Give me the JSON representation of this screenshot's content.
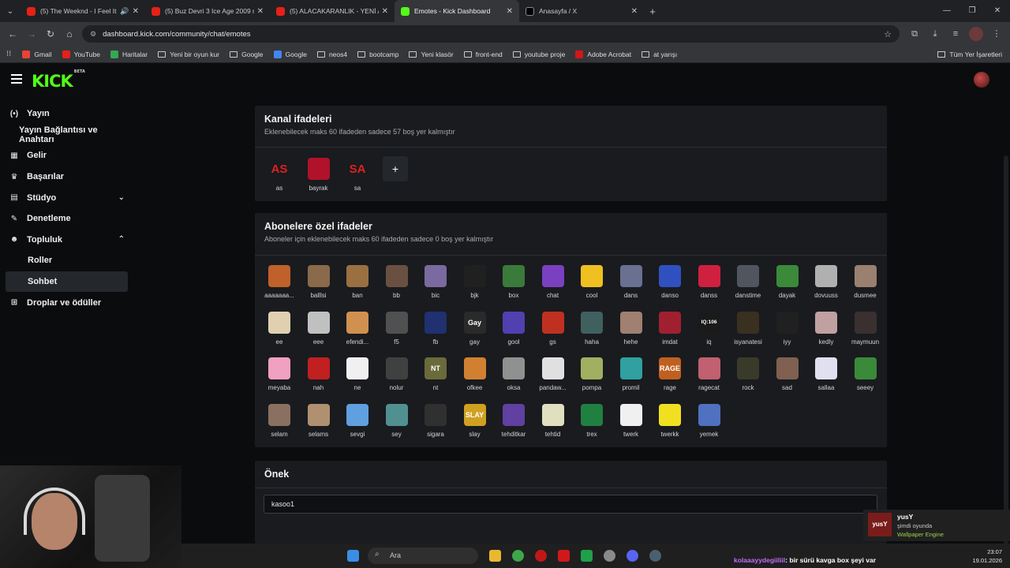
{
  "browser": {
    "tabs": [
      {
        "title": "(5) The Weeknd - I Feel It C",
        "favicon": "youtube",
        "audio": true
      },
      {
        "title": "(5) Buz Devri 3 Ice Age 2009 m",
        "favicon": "youtube"
      },
      {
        "title": "(5) ALACAKARANLIK - YENİ AY",
        "favicon": "youtube"
      },
      {
        "title": "Emotes - Kick Dashboard",
        "favicon": "kick",
        "active": true
      },
      {
        "title": "Anasayfa / X",
        "favicon": "x"
      }
    ],
    "url": "dashboard.kick.com/community/chat/emotes",
    "bookmarks": [
      "Gmail",
      "YouTube",
      "Haritalar",
      "Yeni bir oyun kur",
      "Google",
      "Google",
      "neos4",
      "bootcamp",
      "Yeni klasör",
      "front-end",
      "youtube proje",
      "Adobe Acrobat",
      "at yarışı"
    ],
    "bookmarks_right": "Tüm Yer İşaretleri"
  },
  "logo": {
    "text": "KICK",
    "badge": "BETA"
  },
  "sidebar": {
    "items": [
      {
        "label": "Yayın",
        "icon": "broadcast-icon"
      },
      {
        "label": "Yayın Bağlantısı ve Anahtarı",
        "sub": true
      },
      {
        "label": "Gelir",
        "icon": "revenue-icon"
      },
      {
        "label": "Başarılar",
        "icon": "trophy-icon"
      },
      {
        "label": "Stüdyo",
        "icon": "studio-icon",
        "chevron": "down"
      },
      {
        "label": "Denetleme",
        "icon": "wrench-icon"
      },
      {
        "label": "Topluluk",
        "icon": "people-icon",
        "chevron": "up"
      },
      {
        "label": "Roller",
        "sub2": true
      },
      {
        "label": "Sohbet",
        "sub2": true,
        "active": true
      },
      {
        "label": "Droplar ve ödüller",
        "icon": "gift-icon"
      }
    ]
  },
  "channel_emotes": {
    "title": "Kanal ifadeleri",
    "desc": "Eklenebilecek maks 60 ifadeden sadece 57 boş yer kalmıştır",
    "items": [
      {
        "label": "as",
        "text": "AS",
        "color": "#e02020"
      },
      {
        "label": "bayrak",
        "text": "",
        "color": "#b0122a"
      },
      {
        "label": "sa",
        "text": "SA",
        "color": "#e02020"
      }
    ],
    "add_label": "+"
  },
  "sub_emotes": {
    "title": "Abonelere özel ifadeler",
    "desc": "Aboneler için eklenebilecek maks 60 ifadeden sadece 0 boş yer kalmıştır",
    "items": [
      {
        "label": "aaaaaaa...",
        "color": "#c0602a"
      },
      {
        "label": "balllsi",
        "color": "#8a6a4a"
      },
      {
        "label": "ban",
        "color": "#9a7040"
      },
      {
        "label": "bb",
        "color": "#6a5040"
      },
      {
        "label": "bic",
        "color": "#7a6aa0"
      },
      {
        "label": "bjk",
        "color": "#202020"
      },
      {
        "label": "box",
        "color": "#3a7a3a"
      },
      {
        "label": "chat",
        "color": "#7a40c0"
      },
      {
        "label": "cool",
        "color": "#f0c020"
      },
      {
        "label": "dans",
        "color": "#6a7090"
      },
      {
        "label": "danso",
        "color": "#3050c0"
      },
      {
        "label": "danss",
        "color": "#d02040"
      },
      {
        "label": "danstime",
        "color": "#505560"
      },
      {
        "label": "dayak",
        "color": "#3a8a3a"
      },
      {
        "label": "dovuuss",
        "color": "#b0b0b0"
      },
      {
        "label": "dusmee",
        "color": "#9a8070"
      },
      {
        "label": "ee",
        "color": "#e0d0b0"
      },
      {
        "label": "eee",
        "color": "#c0c0c0"
      },
      {
        "label": "efendi...",
        "color": "#d09050"
      },
      {
        "label": "f5",
        "color": "#505050"
      },
      {
        "label": "fb",
        "color": "#203070"
      },
      {
        "label": "gay",
        "color": "#2a2a2a",
        "text": "Gay"
      },
      {
        "label": "gool",
        "color": "#5040b0"
      },
      {
        "label": "gs",
        "color": "#c03020"
      },
      {
        "label": "haha",
        "color": "#406060"
      },
      {
        "label": "hehe",
        "color": "#a08070"
      },
      {
        "label": "imdat",
        "color": "#a02030"
      },
      {
        "label": "iq",
        "color": "#1a1a1a",
        "text": "IQ:106"
      },
      {
        "label": "isyanatesi",
        "color": "#3a3020"
      },
      {
        "label": "iyy",
        "color": "#202020"
      },
      {
        "label": "kedly",
        "color": "#c0a0a0"
      },
      {
        "label": "maymuun",
        "color": "#3a3030"
      },
      {
        "label": "meyaba",
        "color": "#f0a0c0"
      },
      {
        "label": "nah",
        "color": "#c02020"
      },
      {
        "label": "ne",
        "color": "#f0f0f0"
      },
      {
        "label": "nolur",
        "color": "#404040"
      },
      {
        "label": "nt",
        "color": "#6a6a3a",
        "text": "NT"
      },
      {
        "label": "ofkee",
        "color": "#d08030"
      },
      {
        "label": "oksa",
        "color": "#909090"
      },
      {
        "label": "pandaw...",
        "color": "#e0e0e0"
      },
      {
        "label": "pompa",
        "color": "#a0b060"
      },
      {
        "label": "promil",
        "color": "#30a0a0"
      },
      {
        "label": "rage",
        "color": "#c06020",
        "text": "RAGE"
      },
      {
        "label": "ragecat",
        "color": "#c06070"
      },
      {
        "label": "rock",
        "color": "#3a3a2a"
      },
      {
        "label": "sad",
        "color": "#806050"
      },
      {
        "label": "sallaa",
        "color": "#e0e0f0"
      },
      {
        "label": "seeey",
        "color": "#3a8a3a"
      },
      {
        "label": "selam",
        "color": "#8a7060"
      },
      {
        "label": "selams",
        "color": "#b09070"
      },
      {
        "label": "sevgi",
        "color": "#60a0e0"
      },
      {
        "label": "sey",
        "color": "#509090"
      },
      {
        "label": "sigara",
        "color": "#303030"
      },
      {
        "label": "slay",
        "color": "#d0a020",
        "text": "SLAY"
      },
      {
        "label": "tehditkar",
        "color": "#6040a0"
      },
      {
        "label": "tehtid",
        "color": "#e0e0c0"
      },
      {
        "label": "trex",
        "color": "#208040"
      },
      {
        "label": "twerk",
        "color": "#f0f0f0"
      },
      {
        "label": "twerkk",
        "color": "#f0e020"
      },
      {
        "label": "yemek",
        "color": "#5070c0"
      }
    ]
  },
  "prefix": {
    "title": "Önek",
    "value": "kasoo1"
  },
  "taskbar": {
    "search_placeholder": "Ara",
    "chat_user": "kolaaayydegiiliil",
    "chat_text": ": bir sürü kavga box şeyi var",
    "time": "23:07",
    "date": "19.01.2026"
  },
  "notification": {
    "name": "yusY",
    "status": "şimdi oyunda",
    "game": "Wallpaper Engine",
    "thumb_text": "yusY"
  }
}
